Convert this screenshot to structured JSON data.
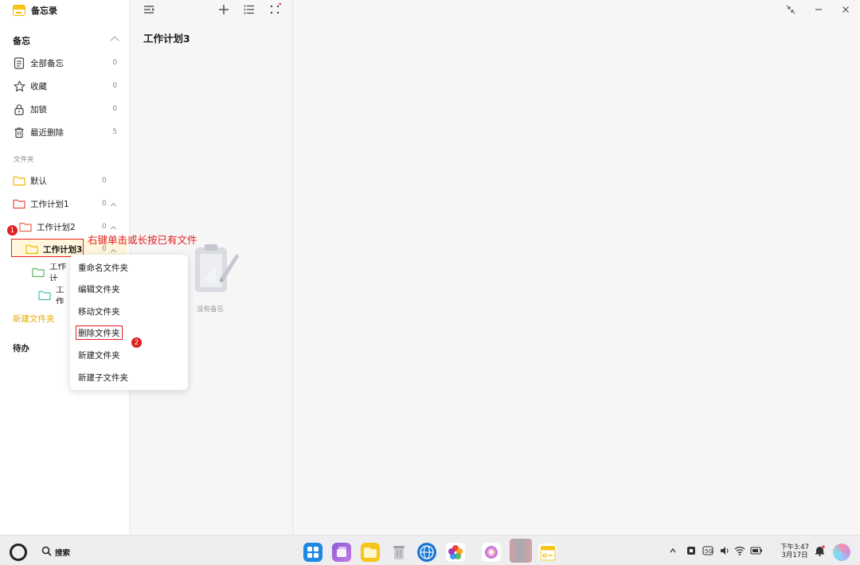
{
  "app": {
    "title": "备忘录",
    "icon": "notes-app-icon"
  },
  "sidebar": {
    "notes_section": {
      "title": "备忘",
      "items": [
        {
          "label": "全部备忘",
          "count": "0",
          "icon": "document-icon"
        },
        {
          "label": "收藏",
          "count": "0",
          "icon": "star-icon"
        },
        {
          "label": "加锁",
          "count": "0",
          "icon": "lock-icon"
        },
        {
          "label": "最近删除",
          "count": "5",
          "icon": "trash-icon"
        }
      ]
    },
    "folders_label": "文件夹",
    "folders": [
      {
        "label": "默认",
        "count": "0",
        "color": "#f5b800"
      },
      {
        "label": "工作计划1",
        "count": "0",
        "color": "#e84b4b"
      },
      {
        "label": "工作计划2",
        "count": "0",
        "color": "#e86a4b"
      },
      {
        "label": "工作计划3",
        "count": "0",
        "color": "#f5b800"
      },
      {
        "label": "工作计",
        "count": "",
        "color": "#5cb85c"
      },
      {
        "label": "工作",
        "count": "",
        "color": "#4bc0b0"
      }
    ],
    "new_folder": "新建文件夹",
    "todo": "待办"
  },
  "list_pane": {
    "title": "工作计划3",
    "empty_text": "没有备忘"
  },
  "context_menu": {
    "items": [
      "重命名文件夹",
      "编辑文件夹",
      "移动文件夹",
      "删除文件夹",
      "新建文件夹",
      "新建子文件夹"
    ]
  },
  "annotations": {
    "step1_badge": "1",
    "step2_badge": "2",
    "instruction": "右键单击或长按已有文件"
  },
  "taskbar": {
    "search_label": "搜索",
    "time": "下午3:47",
    "date": "3月17日"
  },
  "colors": {
    "accent": "#f5b800",
    "annotation": "#e02020"
  }
}
